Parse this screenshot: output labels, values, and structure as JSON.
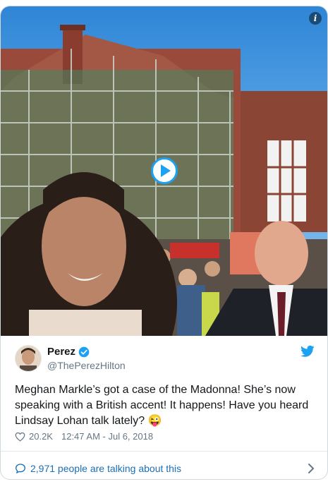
{
  "colors": {
    "accent": "#1da1f2",
    "link": "#1b6fb5",
    "muted": "#657786",
    "text": "#14171a"
  },
  "media": {
    "info_icon": "info-icon",
    "info_glyph": "i",
    "play_icon": "play-icon"
  },
  "author": {
    "name": "Perez",
    "handle": "@ThePerezHilton",
    "verified": true,
    "bird_icon": "twitter-bird-icon"
  },
  "tweet": {
    "text": "Meghan Markle’s got a case of the Madonna! She’s now speaking with a British accent! It happens! Have you heard Lindsay Lohan talk lately? 😜"
  },
  "meta": {
    "likes": "20.2K",
    "timestamp": "12:47 AM - Jul 6, 2018"
  },
  "footer": {
    "label": "2,971 people are talking about this"
  }
}
